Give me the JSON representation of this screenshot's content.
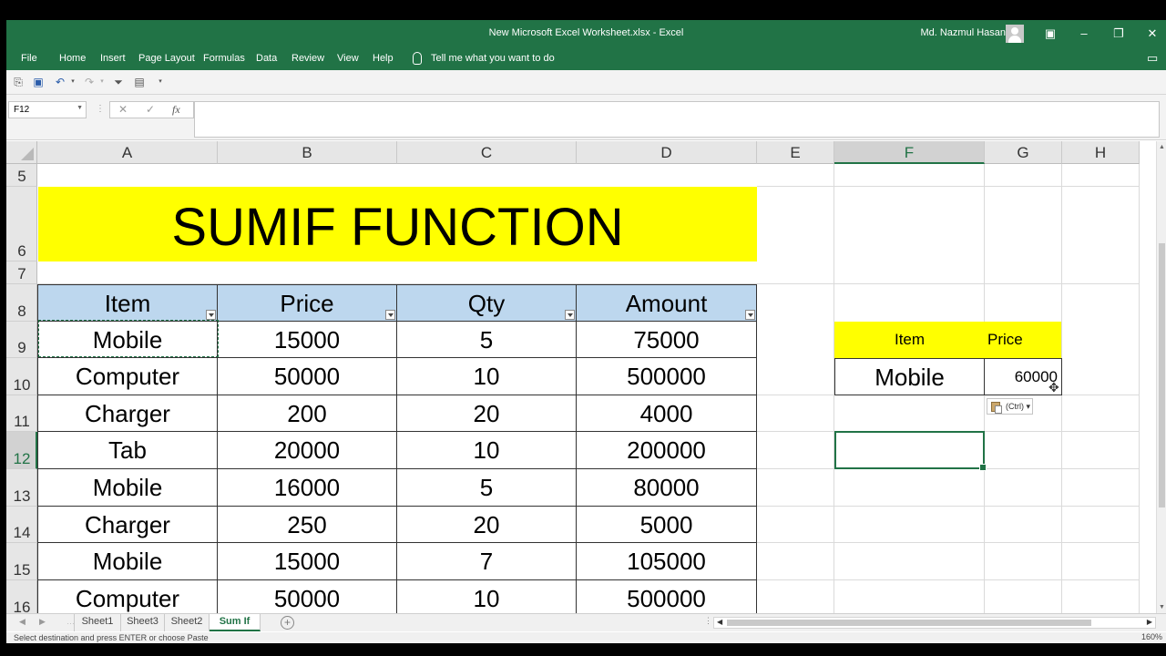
{
  "window": {
    "title": "New Microsoft Excel Worksheet.xlsx  -  Excel",
    "user": "Md. Nazmul Hasan"
  },
  "menu": {
    "items": [
      "File",
      "Home",
      "Insert",
      "Page Layout",
      "Formulas",
      "Data",
      "Review",
      "View",
      "Help"
    ],
    "tellme": "Tell me what you want to do"
  },
  "formula_bar": {
    "name_box": "F12",
    "cancel": "✕",
    "enter": "✓",
    "fx": "fx",
    "content": ""
  },
  "columns": [
    "A",
    "B",
    "C",
    "D",
    "E",
    "F",
    "G",
    "H"
  ],
  "selected_column": "F",
  "rows": [
    "5",
    "6",
    "7",
    "8",
    "9",
    "10",
    "11",
    "12",
    "13",
    "14",
    "15",
    "16"
  ],
  "selected_row": "12",
  "banner": "SUMIF FUNCTION",
  "table": {
    "headers": [
      "Item",
      "Price",
      "Qty",
      "Amount"
    ],
    "rows": [
      [
        "Mobile",
        "15000",
        "5",
        "75000"
      ],
      [
        "Computer",
        "50000",
        "10",
        "500000"
      ],
      [
        "Charger",
        "200",
        "20",
        "4000"
      ],
      [
        "Tab",
        "20000",
        "10",
        "200000"
      ],
      [
        "Mobile",
        "16000",
        "5",
        "80000"
      ],
      [
        "Charger",
        "250",
        "20",
        "5000"
      ],
      [
        "Mobile",
        "15000",
        "7",
        "105000"
      ],
      [
        "Computer",
        "50000",
        "10",
        "500000"
      ]
    ]
  },
  "criteria": {
    "headers": [
      "Item",
      "Price"
    ],
    "item": "Mobile",
    "price": "60000"
  },
  "paste_options": "(Ctrl)",
  "sheet_tabs": [
    "Sheet1",
    "Sheet3",
    "Sheet2",
    "Sum If"
  ],
  "active_sheet": "Sum If",
  "status": {
    "message": "Select destination and press ENTER or choose Paste",
    "zoom": "160%"
  },
  "colors": {
    "excel_green": "#217346",
    "banner_yellow": "#ffff00",
    "table_header_blue": "#bdd7ee"
  }
}
